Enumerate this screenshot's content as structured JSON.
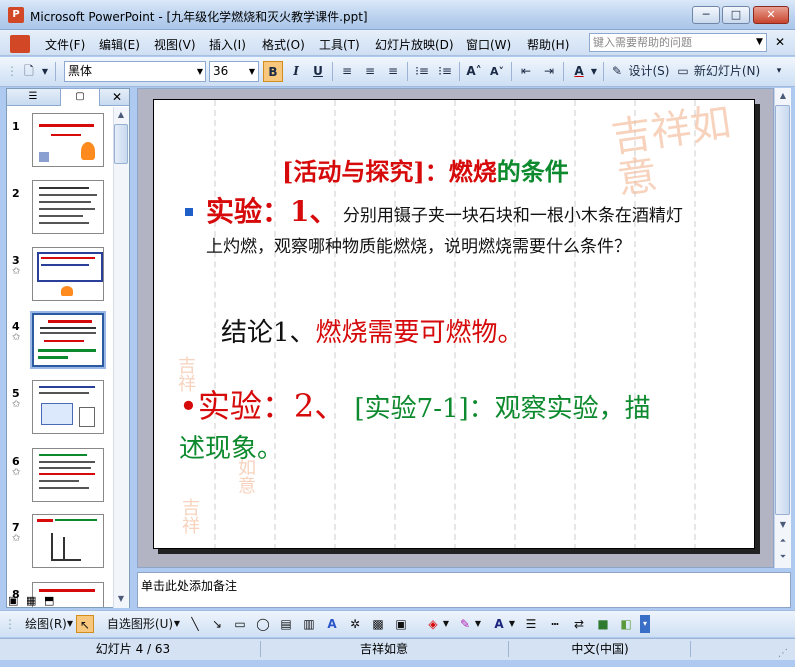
{
  "window": {
    "title": "Microsoft PowerPoint - [九年级化学燃烧和灭火教学课件.ppt]",
    "app_icon_letter": "P",
    "buttons": {
      "minimize": "─",
      "maximize": "□",
      "close": "✕"
    }
  },
  "menubar": {
    "items": [
      "文件(F)",
      "编辑(E)",
      "视图(V)",
      "插入(I)",
      "格式(O)",
      "工具(T)",
      "幻灯片放映(D)",
      "窗口(W)",
      "帮助(H)"
    ],
    "help_placeholder": "键入需要帮助的问题"
  },
  "toolbar": {
    "font_name": "黑体",
    "font_size": "36",
    "bold": "B",
    "italic": "I",
    "underline": "U",
    "design_label": "设计(S)",
    "new_slide_label": "新幻灯片(N)"
  },
  "left_panel": {
    "tab_outline_icon": "outline-icon",
    "tab_slides_icon": "slides-icon",
    "close": "✕",
    "slides": [
      {
        "num": "1",
        "star": false
      },
      {
        "num": "2",
        "star": false
      },
      {
        "num": "3",
        "star": true
      },
      {
        "num": "4",
        "star": true,
        "selected": true
      },
      {
        "num": "5",
        "star": true
      },
      {
        "num": "6",
        "star": true
      },
      {
        "num": "7",
        "star": true
      },
      {
        "num": "8",
        "star": false
      }
    ]
  },
  "slide": {
    "title_part1": "[活动与探究]：",
    "title_part2": "燃烧",
    "title_part3": "的条件",
    "exp1_label": "实验：1、",
    "exp1_text": "分别用镊子夹一块石块和一根小木条在酒精灯上灼燃，观察哪种物质能燃烧，说明燃烧需要什么条件？",
    "conclusion_prefix": "结论1、",
    "conclusion_text": "燃烧需要可燃物。",
    "exp2_label": "•实验：2、",
    "exp2_text": "[实验7-1]：观察实验，描述现象。",
    "seal_text": "吉祥如意",
    "colors": {
      "red": "#d60a0a",
      "green": "#0d8a2d",
      "bullet": "#1f5fc8"
    }
  },
  "notes": {
    "placeholder": "单击此处添加备注"
  },
  "drawbar": {
    "draw_label": "绘图(R)",
    "autoshape_label": "自选图形(U)"
  },
  "statusbar": {
    "slide_info": "幻灯片 4 / 63",
    "template": "吉祥如意",
    "language": "中文(中国)"
  }
}
